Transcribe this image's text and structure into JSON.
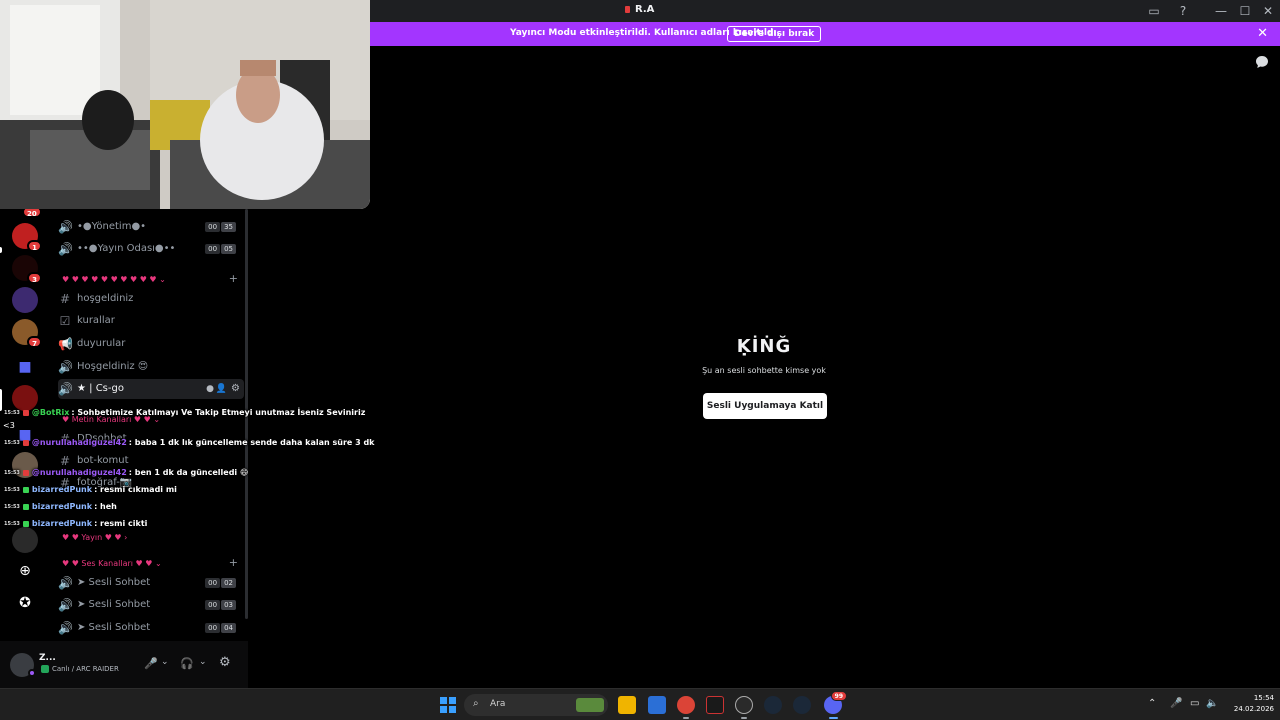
{
  "window": {
    "title": "R.A"
  },
  "banner": {
    "message": "Yayıncı Modu etkinleştirildi. Kullanıcı adları kısaltıldı.",
    "button_label": "Devre dışı bırak"
  },
  "rail": {
    "top_badge": "20",
    "servers": [
      {
        "badge": "1"
      },
      {
        "badge": "3"
      },
      {
        "badge": ""
      },
      {
        "badge": "7"
      },
      {
        "badge": ""
      },
      {
        "badge": ""
      },
      {
        "badge": ""
      }
    ],
    "side_text": "<3"
  },
  "channels": {
    "voice_top": [
      {
        "name": "•●Yönetim●•",
        "count": [
          "00",
          "35"
        ]
      },
      {
        "name": "••●Yayın Odası●••",
        "count": [
          "00",
          "05"
        ]
      }
    ],
    "category1": "♥ ♥ ♥ ♥ ♥ ♥ ♥ ♥ ♥ ♥ ⌄",
    "text": [
      {
        "icon": "#",
        "name": "hoşgeldiniz"
      },
      {
        "icon": "☑",
        "name": "kurallar"
      },
      {
        "icon": "📢",
        "name": "duyurular"
      },
      {
        "icon": "🔊",
        "name": "Hoşgeldiniz 😍"
      },
      {
        "icon": "🔊",
        "name": "★ | Cs-go"
      }
    ],
    "category2": "♥ Metin Kanalları ♥ ♥ ⌄",
    "text2": [
      {
        "icon": "#",
        "name": "DDsohbet"
      },
      {
        "icon": "#",
        "name": "bot-komut"
      },
      {
        "icon": "#",
        "name": "fotoğraf-📷"
      }
    ],
    "category_yayin": "♥ ♥ Yayın ♥ ♥ ›",
    "category3": "♥ ♥ Ses Kanalları ♥ ♥ ⌄",
    "voice": [
      {
        "name": "➤ Sesli Sohbet",
        "count": [
          "00",
          "02"
        ]
      },
      {
        "name": "➤ Sesli Sohbet",
        "count": [
          "00",
          "03"
        ]
      },
      {
        "name": "➤ Sesli Sohbet",
        "count": [
          "00",
          "04"
        ]
      }
    ]
  },
  "user": {
    "name": "Z...",
    "activity": "Canlı / ARC RAIDER"
  },
  "overlay": [
    {
      "time": "15:53",
      "user": "@BotRix",
      "text": ": Sohbetimize Katılmayı Ve Takip Etmeyi unutmaz İseniz Seviniriz",
      "color": "#39d353"
    },
    {
      "time": "15:53",
      "user": "@nurullahadiguzel42",
      "text": ": baba 1 dk lık güncelleme sende daha kalan süre 3 dk",
      "color": "#9b59f6"
    },
    {
      "time": "15:53",
      "user": "@nurullahadiguzel42",
      "text": ": ben 1 dk da güncelledi 😄",
      "color": "#9b59f6"
    },
    {
      "time": "15:53",
      "user": "bizarredPunk",
      "text": ": resmi cıkmadi mi",
      "color": "#8fb8ff"
    },
    {
      "time": "15:53",
      "user": "bizarredPunk",
      "text": ": heh",
      "color": "#8fb8ff"
    },
    {
      "time": "15:53",
      "user": "bizarredPunk",
      "text": ": resmi cikti",
      "color": "#8fb8ff"
    }
  ],
  "voice_area": {
    "title": "ḲİṄĞ",
    "subtitle": "Şu an sesli sohbette kimse yok",
    "join_label": "Sesli Uygulamaya Katıl"
  },
  "taskbar": {
    "search_label": "Ara",
    "time": "15:54",
    "date": "24.02.2026",
    "discord_badge": "99"
  }
}
